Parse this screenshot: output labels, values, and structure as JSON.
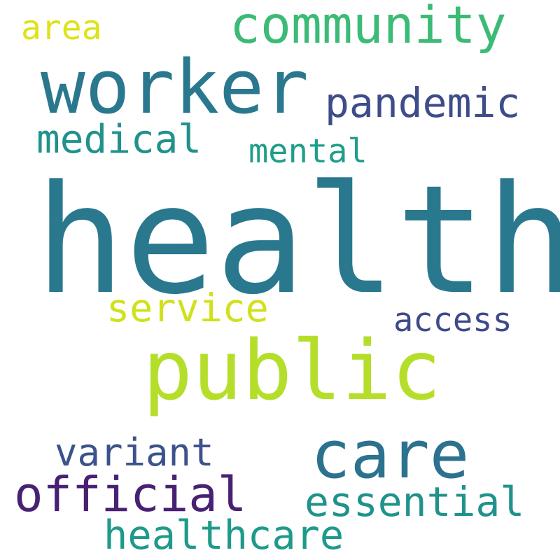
{
  "words": [
    {
      "text": "health",
      "color": "#2a788e"
    },
    {
      "text": "public",
      "color": "#b5de2b"
    },
    {
      "text": "worker",
      "color": "#2a788e"
    },
    {
      "text": "care",
      "color": "#2c728e"
    },
    {
      "text": "community",
      "color": "#3bbb75"
    },
    {
      "text": "official",
      "color": "#482173"
    },
    {
      "text": "pandemic",
      "color": "#3e4c8a"
    },
    {
      "text": "essential",
      "color": "#20928c"
    },
    {
      "text": "healthcare",
      "color": "#1f9a8a"
    },
    {
      "text": "service",
      "color": "#d0e11c"
    },
    {
      "text": "medical",
      "color": "#21918c"
    },
    {
      "text": "variant",
      "color": "#3b528b"
    },
    {
      "text": "mental",
      "color": "#1f9e89"
    },
    {
      "text": "access",
      "color": "#3e4a89"
    },
    {
      "text": "area",
      "color": "#dde318"
    }
  ]
}
